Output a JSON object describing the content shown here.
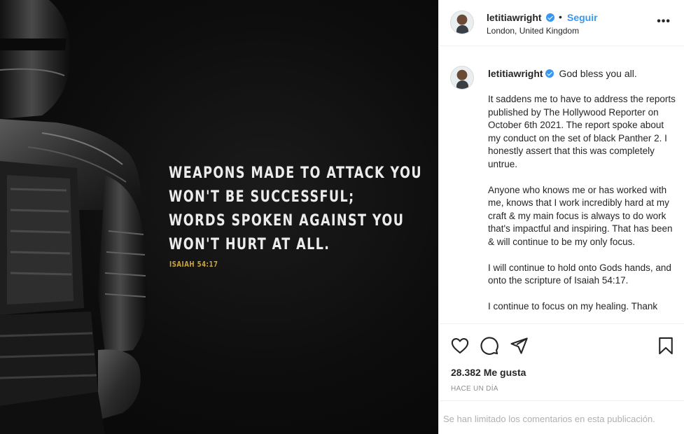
{
  "media": {
    "verse_lines": [
      "WEAPONS MADE TO ATTACK YOU",
      "WON'T BE SUCCESSFUL;",
      "WORDS SPOKEN AGAINST YOU",
      "WON'T HURT AT ALL."
    ],
    "verse_reference": "ISAIAH 54:17",
    "reference_color": "#c9a53d"
  },
  "header": {
    "username": "letitiawright",
    "separator": "•",
    "follow_label": "Seguir",
    "location": "London, United Kingdom",
    "more_label": "•••"
  },
  "caption": {
    "username": "letitiawright",
    "first_line": "God bless you all.",
    "paragraphs": [
      "It saddens me to have to address the reports published by The Hollywood Reporter on October 6th 2021. The report spoke about my conduct on the set of black Panther 2. I honestly assert that this was completely untrue.",
      "Anyone who knows me or has worked with me, knows that I work incredibly hard at my craft & my main focus is always to do work that's impactful and inspiring. That has been & will continue to be my only focus.",
      "I will continue to hold onto Gods hands, and onto the scripture of Isaiah 54:17.",
      "I continue to focus on my healing. Thank"
    ]
  },
  "actions": {
    "icons": [
      "heart-icon",
      "comment-icon",
      "share-icon",
      "bookmark-icon"
    ]
  },
  "likes_text": "28.382 Me gusta",
  "timestamp": "HACE UN DÍA",
  "comments_notice": "Se han limitado los comentarios en esta publicación.",
  "colors": {
    "link": "#3897f0",
    "verified": "#3897f0"
  }
}
